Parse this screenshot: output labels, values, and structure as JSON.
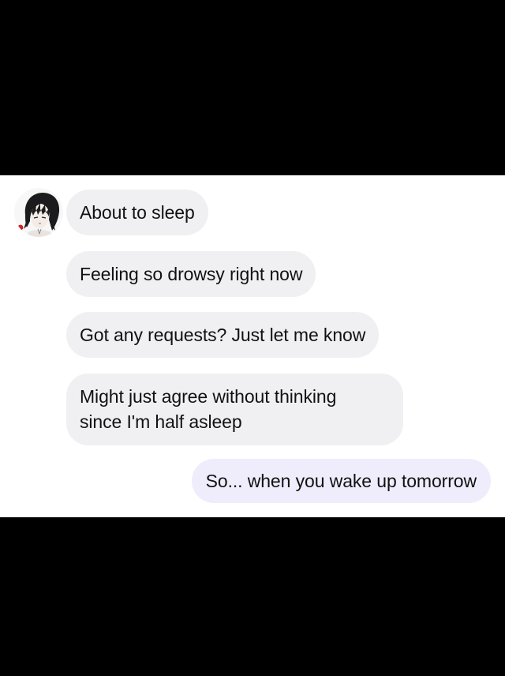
{
  "conversation": {
    "incoming_messages": [
      {
        "text": "About to sleep"
      },
      {
        "text": "Feeling so drowsy right now"
      },
      {
        "text": "Got any requests? Just let me know"
      },
      {
        "lines": [
          "Might just agree without thinking",
          "since I'm half asleep"
        ]
      }
    ],
    "outgoing_messages": [
      {
        "text": "So... when you wake up tomorrow"
      }
    ]
  },
  "contact": {
    "avatar_icon": "anime-girl-avatar-icon"
  },
  "colors": {
    "incoming_bubble": "#f0f0f2",
    "outgoing_bubble": "#efedfc",
    "text": "#111111",
    "background": "#ffffff",
    "letterbox": "#000000"
  }
}
